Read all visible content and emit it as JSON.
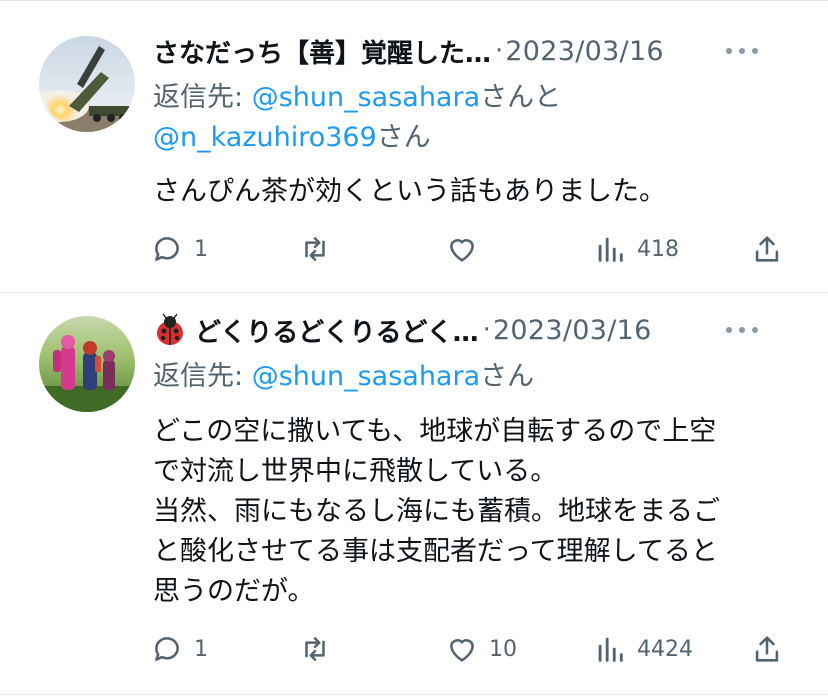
{
  "tweets": [
    {
      "display_name": "さなだっち【善】覚醒した…",
      "separator": "·",
      "date": "2023/03/16",
      "reply_prefix": "返信先: ",
      "reply_handles": [
        "@shun_sasahara",
        "@n_kazuhiro369"
      ],
      "reply_joiner": "さんと",
      "reply_suffix": "さん",
      "text_lines": [
        "さんぴん茶が効くという話もありました。"
      ],
      "stats": {
        "replies": "1",
        "retweets": "",
        "likes": "",
        "views": "418"
      },
      "avatar": "rocket-launch-photo"
    },
    {
      "display_name": "どくりるどくりるどく…",
      "badge_icon": "ladybug-icon",
      "separator": "·",
      "date": "2023/03/16",
      "reply_prefix": "返信先: ",
      "reply_handles": [
        "@shun_sasahara"
      ],
      "reply_suffix": "さん",
      "text_lines": [
        "どこの空に撒いても、地球が自転するので上空",
        "で対流し世界中に飛散している。",
        "当然、雨にもなるし海にも蓄積。地球をまるご",
        "と酸化させてる事は支配者だって理解してると",
        "思うのだが。"
      ],
      "stats": {
        "replies": "1",
        "retweets": "",
        "likes": "10",
        "views": "4424"
      },
      "avatar": "figures-on-grass-photo"
    }
  ],
  "colors": {
    "handle": "#1d9bf0",
    "muted": "#536471",
    "text": "#0f1419",
    "divider": "#e6e9ec"
  }
}
